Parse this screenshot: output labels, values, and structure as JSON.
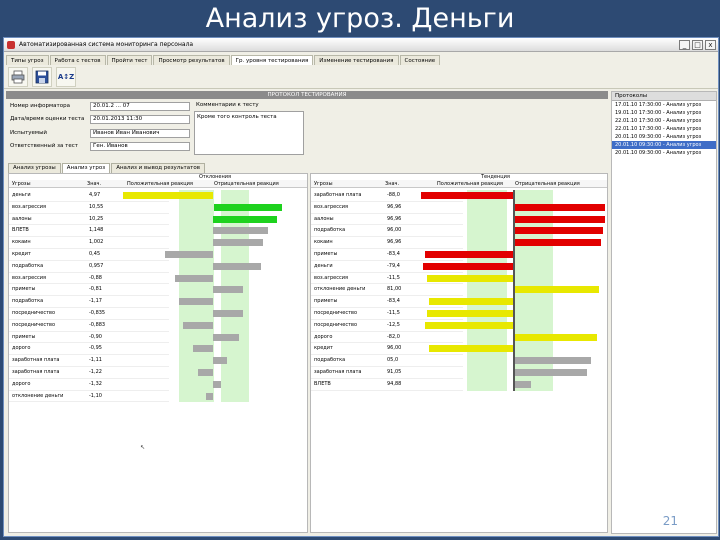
{
  "slide": {
    "title": "Анализ угроз. Деньги",
    "page_number": "21"
  },
  "window": {
    "title": "Автоматизированная система мониторинга персонала",
    "minimize": "_",
    "maximize": "□",
    "close": "x"
  },
  "menu": {
    "tabs": [
      "Типы угроз",
      "Работа с тестов",
      "Пройти тест",
      "Просмотр результатов",
      "Гр. уровня тестирования",
      "Изменение тестирования",
      "Состояние"
    ],
    "active_index": 4
  },
  "toolbar": {
    "buttons": [
      "print-icon",
      "save-icon",
      "sort-az-icon"
    ],
    "sort_label": "A↕Z"
  },
  "protocol": {
    "header": "ПРОТОКОЛ ТЕСТИРОВАНИЯ",
    "fields": [
      {
        "label": "Номер информатора",
        "value": "20.01.2 ... 07"
      },
      {
        "label": "Дата/время оценки теста",
        "value": "20.01.2013 11:30"
      },
      {
        "label": "Испытуемый",
        "value": "Иванов Иван Иванович"
      },
      {
        "label": "Ответственный за тест",
        "value": "Ген. Иванов"
      }
    ],
    "comment_label": "Комментарии к тесту",
    "comment_value": "Кроме того контроль теста"
  },
  "subtabs": {
    "items": [
      "Анализ угрозы",
      "Анализ угроз",
      "Анализ и вывод результатов"
    ],
    "active_index": 1
  },
  "left_panel": {
    "group_label": "Отклонения",
    "col_name": "Угрозы",
    "col_value": "Знач.",
    "col_pos_reaction": "Положительная реакция",
    "col_neg_reaction": "Отрицательная реакция",
    "rows": [
      {
        "name": "деньги",
        "value": "4,97"
      },
      {
        "name": "воз.агрессия",
        "value": "10,55"
      },
      {
        "name": "аалоны",
        "value": "10,25"
      },
      {
        "name": "ВЛЕТВ",
        "value": "1,148"
      },
      {
        "name": "кокаин",
        "value": "1,002"
      },
      {
        "name": "кредит",
        "value": "0,45"
      },
      {
        "name": "подработка",
        "value": "0,957"
      },
      {
        "name": "воз.агрессия",
        "value": "-0,88"
      },
      {
        "name": "приметы",
        "value": "-0,81"
      },
      {
        "name": "подработка",
        "value": "-1,17"
      },
      {
        "name": "посредничество",
        "value": "-0,835"
      },
      {
        "name": "посредничество",
        "value": "-0,883"
      },
      {
        "name": "приметы",
        "value": "-0,90"
      },
      {
        "name": "дорого",
        "value": "-0,95"
      },
      {
        "name": "заработная плата",
        "value": "-1,11"
      },
      {
        "name": "заработная плата",
        "value": "-1,22"
      },
      {
        "name": "дорого",
        "value": "-1,32"
      },
      {
        "name": "отклонение деньги",
        "value": "-1,10"
      }
    ]
  },
  "right_panel": {
    "group_label": "Тенденция",
    "col_name": "Угрозы",
    "col_value": "Знач.",
    "col_pos_reaction": "Положительная реакция",
    "col_neg_reaction": "Отрицательная реакция",
    "rows": [
      {
        "name": "заработная плата",
        "value": "-88,0"
      },
      {
        "name": "воз.агрессия",
        "value": "96,96"
      },
      {
        "name": "аалоны",
        "value": "96,96"
      },
      {
        "name": "подработка",
        "value": "96,00"
      },
      {
        "name": "кокаин",
        "value": "96,96"
      },
      {
        "name": "приметы",
        "value": "-83,4"
      },
      {
        "name": "деньги",
        "value": "-79,4"
      },
      {
        "name": "воз.агрессия",
        "value": "-11,5"
      },
      {
        "name": "отклонение деньги",
        "value": "81,00"
      },
      {
        "name": "приметы",
        "value": "-83,4"
      },
      {
        "name": "посредничество",
        "value": "-11,5"
      },
      {
        "name": "посредничество",
        "value": "-12,5"
      },
      {
        "name": "дорого",
        "value": "-82,0"
      },
      {
        "name": "кредит",
        "value": "96,00"
      },
      {
        "name": "подработка",
        "value": "05,0"
      },
      {
        "name": "заработная плата",
        "value": "91,05"
      },
      {
        "name": "ВЛЕТВ",
        "value": "94,88"
      }
    ]
  },
  "protocols_list": {
    "title": "Протоколы",
    "items": [
      "17.01.10 17:30:00 - Анализ угроз",
      "19.01.10 17:30:00 - Анализ угроз",
      "22.01.10 17:30:00 - Анализ угроз",
      "22.01.10 17:30:00 - Анализ угроз",
      "20.01.10 09:30:00 - Анализ угроз",
      "20.01.10 09:30:00 - Анализ угроз",
      "20.01.10 09:30:00 - Анализ угроз"
    ],
    "selected_index": 5
  },
  "colors": {
    "slide_bg": "#2d4a73",
    "window_bg": "#f0efe6",
    "selection": "#3f6dc7",
    "zone_green": "#d6f5cf",
    "bar_yellow": "#e8e800",
    "bar_green": "#1ed21e",
    "bar_gray": "#a8a8a8",
    "bar_red": "#e20000"
  }
}
